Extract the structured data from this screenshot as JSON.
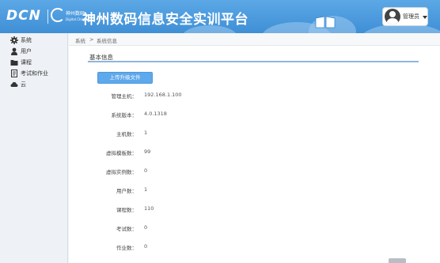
{
  "header": {
    "logo_text": "DCN",
    "logo_cn": "神州数码",
    "logo_en": "Digital China",
    "app_title": "神州数码信息安全实训平台",
    "user": {
      "name": "管理员"
    }
  },
  "sidebar": {
    "items": [
      {
        "label": "系统",
        "icon": "gear-icon"
      },
      {
        "label": "用户",
        "icon": "user-icon"
      },
      {
        "label": "课程",
        "icon": "folder-icon"
      },
      {
        "label": "考试和作业",
        "icon": "document-icon"
      },
      {
        "label": "云",
        "icon": "cloud-icon"
      }
    ]
  },
  "breadcrumb": {
    "items": [
      "系统",
      "系统信息"
    ],
    "separator": ">"
  },
  "main": {
    "section_title": "基本信息",
    "upload_button": "上传升级文件",
    "info_rows": [
      {
        "label": "管理主机：",
        "value": "192.168.1.100"
      },
      {
        "label": "系统版本：",
        "value": "4.0.1318"
      },
      {
        "label": "主机数：",
        "value": "1"
      },
      {
        "label": "虚拟模板数：",
        "value": "99"
      },
      {
        "label": "虚拟实例数：",
        "value": "0"
      },
      {
        "label": "用户数：",
        "value": "1"
      },
      {
        "label": "课程数：",
        "value": "110"
      },
      {
        "label": "考试数：",
        "value": "0"
      },
      {
        "label": "作业数：",
        "value": "0"
      }
    ]
  }
}
